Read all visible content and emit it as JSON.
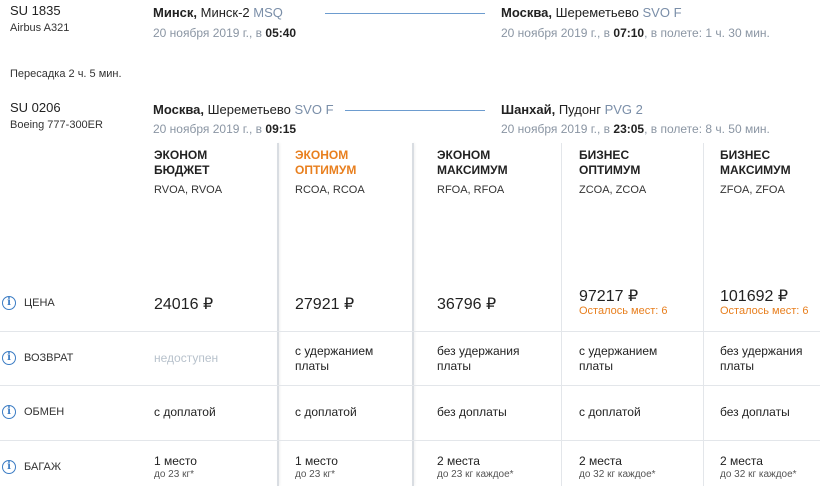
{
  "segments": [
    {
      "code": "SU 1835",
      "aircraft": "Airbus A321",
      "from": {
        "city": "Минск,",
        "airport": " Минск-2 ",
        "code": "MSQ"
      },
      "to": {
        "city": "Москва,",
        "airport": " Шереметьево ",
        "code": "SVO F"
      },
      "dep_date": "20 ноября 2019 г., в ",
      "dep_time": "05:40",
      "arr_date": "20 ноября 2019 г., в ",
      "arr_time": "07:10",
      "duration": ", в полете: 1 ч. 30 мин."
    },
    {
      "code": "SU 0206",
      "aircraft": "Boeing 777-300ER",
      "from": {
        "city": "Москва,",
        "airport": " Шереметьево ",
        "code": "SVO F"
      },
      "to": {
        "city": "Шанхай,",
        "airport": " Пудонг ",
        "code": "PVG 2"
      },
      "dep_date": "20 ноября 2019 г., в ",
      "dep_time": "09:15",
      "arr_date": "20 ноября 2019 г., в ",
      "arr_time": "23:05",
      "duration": ", в полете: 8 ч. 50 мин."
    }
  ],
  "transfer": "Пересадка 2 ч. 5 мин.",
  "fares": [
    {
      "line1": "ЭКОНОМ",
      "line2": "БЮДЖЕТ",
      "codes": "RVOA, RVOA",
      "price": "24016 ₽",
      "seats_left": "",
      "refund": "недоступен",
      "exchange": "с доплатой",
      "baggage": "1 место",
      "baggage_note": "до 23 кг*"
    },
    {
      "line1": "ЭКОНОМ",
      "line2": "ОПТИМУМ",
      "codes": "RCOA, RCOA",
      "price": "27921 ₽",
      "seats_left": "",
      "refund": "с удержанием платы",
      "exchange": "с доплатой",
      "baggage": "1 место",
      "baggage_note": "до 23 кг*"
    },
    {
      "line1": "ЭКОНОМ",
      "line2": "МАКСИМУМ",
      "codes": "RFOA, RFOA",
      "price": "36796 ₽",
      "seats_left": "",
      "refund": "без удержания платы",
      "exchange": "без доплаты",
      "baggage": "2 места",
      "baggage_note": "до 23 кг каждое*"
    },
    {
      "line1": "БИЗНЕС",
      "line2": "ОПТИМУМ",
      "codes": "ZCOA, ZCOA",
      "price": "97217 ₽",
      "seats_left": "Осталось мест: 6",
      "refund": "с удержанием платы",
      "exchange": "с доплатой",
      "baggage": "2 места",
      "baggage_note": "до 32 кг каждое*"
    },
    {
      "line1": "БИЗНЕС",
      "line2": "МАКСИМУМ",
      "codes": "ZFOA, ZFOA",
      "price": "101692 ₽",
      "seats_left": "Осталось мест: 6",
      "refund": "без удержания платы",
      "exchange": "без доплаты",
      "baggage": "2 места",
      "baggage_note": "до 32 кг каждое*"
    }
  ],
  "rows": {
    "price": "ЦЕНА",
    "refund": "ВОЗВРАТ",
    "exchange": "ОБМЕН",
    "baggage": "БАГАЖ"
  },
  "info_icon_glyph": "i",
  "colors": {
    "accent": "#e87f1e",
    "link": "#3b7cc4",
    "muted": "#8a95a3",
    "disabled": "#b8c2cc"
  }
}
